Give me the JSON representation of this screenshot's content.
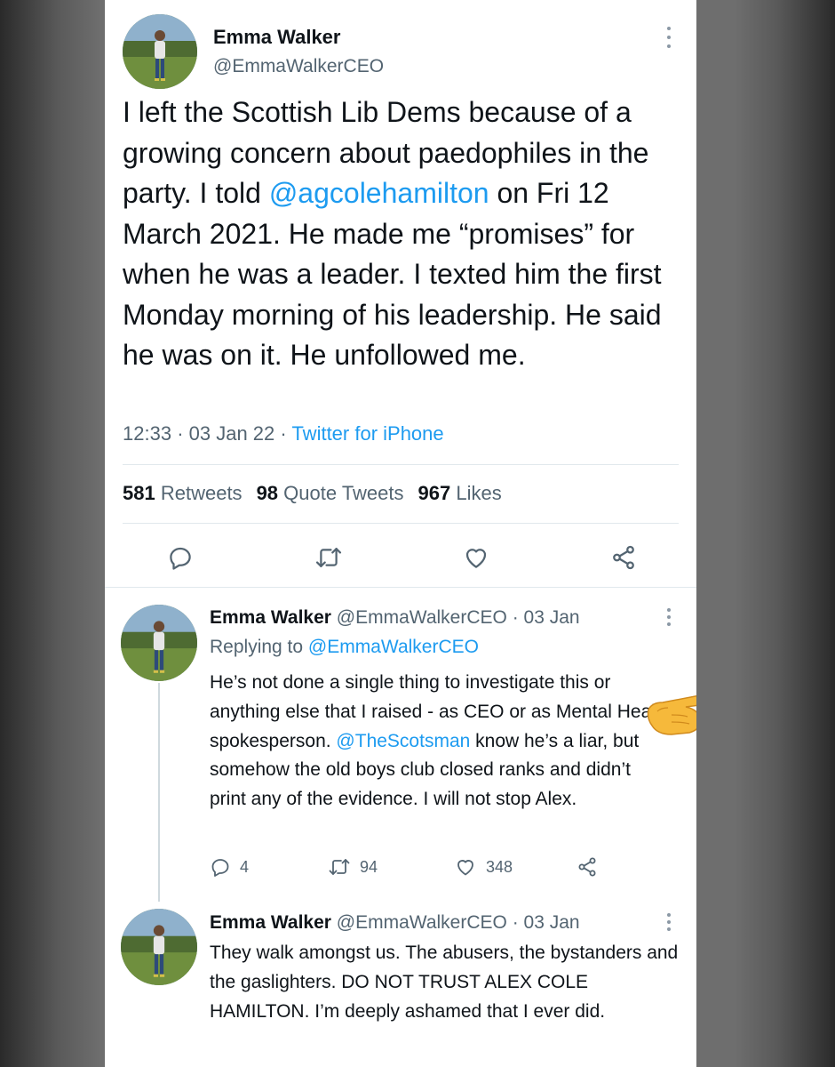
{
  "main_tweet": {
    "name": "Emma Walker",
    "handle": "@EmmaWalkerCEO",
    "text_before_mention": "I left the Scottish Lib Dems because of a growing concern about paedophiles in the party. I told ",
    "mention": "@agcolehamilton",
    "text_after_mention": " on Fri 12 March 2021. He made me “promises” for when he was a leader. I texted him the first Monday morning of his leadership. He said he was on it. He unfollowed me.",
    "time": "12:33",
    "date": "03 Jan 22",
    "source": "Twitter for iPhone",
    "separator": "·",
    "stats": {
      "retweets_count": "581",
      "retweets_label": "Retweets",
      "quotes_count": "98",
      "quotes_label": "Quote Tweets",
      "likes_count": "967",
      "likes_label": "Likes"
    }
  },
  "replies": [
    {
      "name": "Emma Walker",
      "handle": "@EmmaWalkerCEO",
      "date": "· 03 Jan",
      "replying_prefix": "Replying to ",
      "replying_to": "@EmmaWalkerCEO",
      "text_before_mention": "He’s not done a single thing to investigate this or anything else that I raised - as CEO or as Mental Health spokesperson. ",
      "mention": "@TheScotsman",
      "text_after_mention": " know he’s a liar, but somehow the old boys club closed ranks and didn’t print any of the evidence. I will not stop Alex.",
      "reply_count": "4",
      "retweet_count": "94",
      "like_count": "348"
    },
    {
      "name": "Emma Walker",
      "handle": "@EmmaWalkerCEO",
      "date": "· 03 Jan",
      "text": "They walk amongst us. The abusers, the bystanders and the gaslighters. DO NOT TRUST ALEX COLE HAMILTON. I’m deeply ashamed that I ever did."
    }
  ],
  "icons": [
    "avatar-photo",
    "more-icon",
    "reply-icon",
    "retweet-icon",
    "like-icon",
    "share-icon",
    "pointing-hand-emoji"
  ],
  "colors": {
    "link": "#1d9bf0",
    "text": "#0f1419",
    "muted": "#536471",
    "divider": "#e1e8ed",
    "backdrop": "#6e6e6e"
  }
}
